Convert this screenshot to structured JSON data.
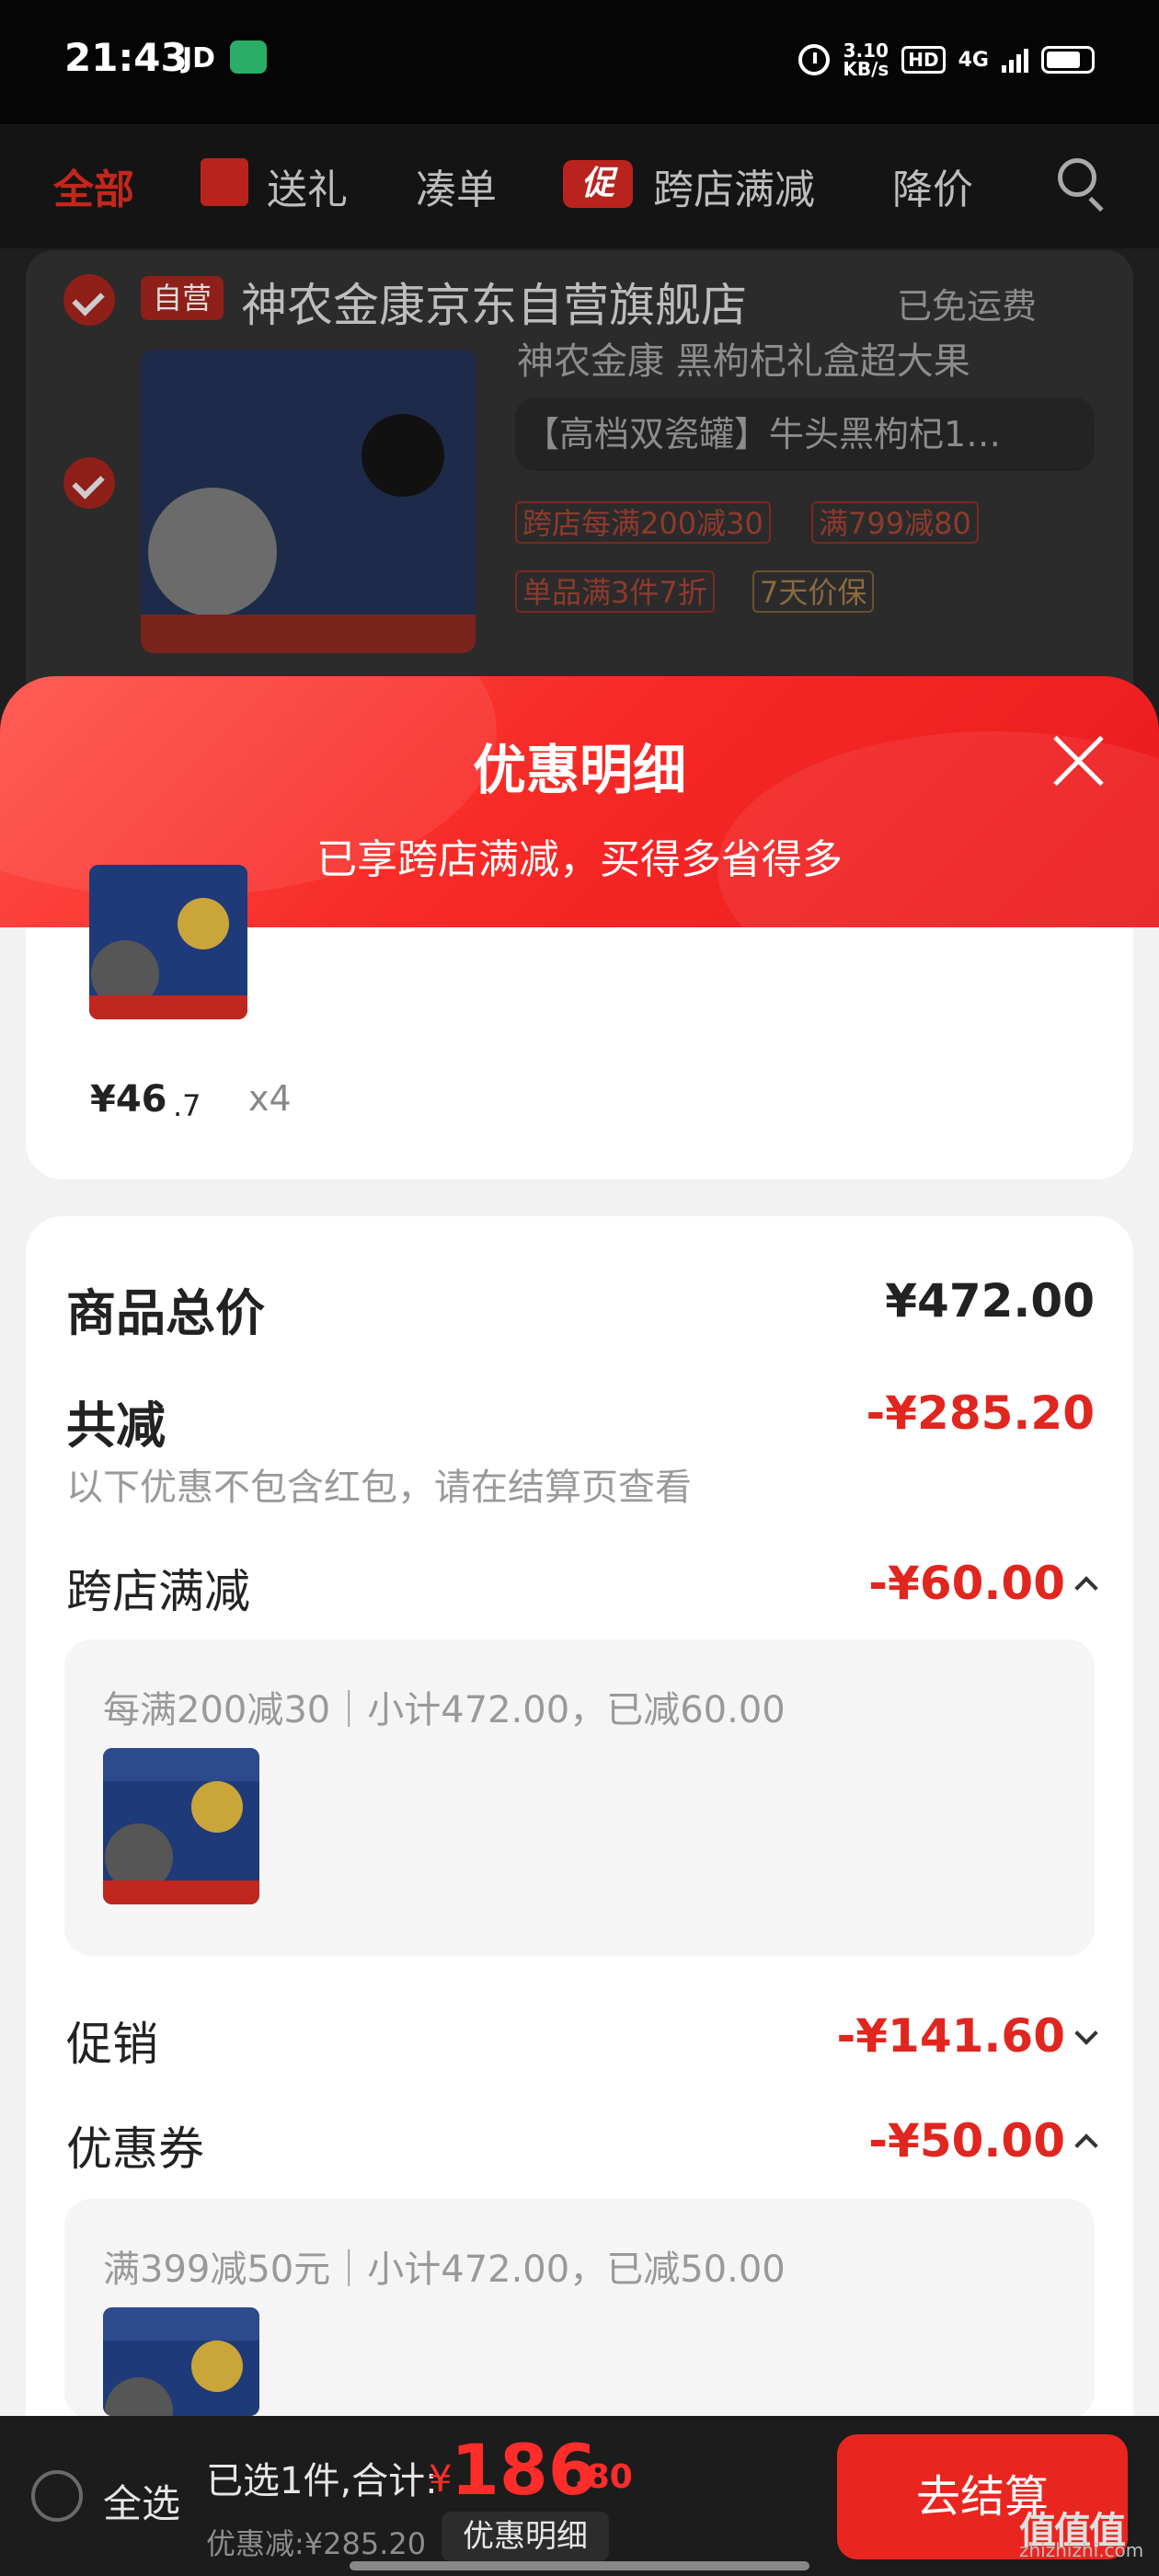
{
  "status_bar": {
    "time": "21:43",
    "app_tag": "JD",
    "speed": "3.10",
    "speed_unit": "KB/s",
    "hd": "HD",
    "network": "4G"
  },
  "tabs": [
    {
      "label": "全部",
      "active": true
    },
    {
      "label": "送礼",
      "icon": "gift-icon"
    },
    {
      "label": "凑单"
    },
    {
      "label": "跨店满减",
      "badge": "促"
    },
    {
      "label": "降价"
    }
  ],
  "shop": {
    "badge": "自营",
    "name": "神农金康京东自营旗舰店",
    "shipping": "已免运费",
    "product": {
      "title_partial": "神农金康 黑枸杞礼盒超大果",
      "spec": "【高档双瓷罐】牛头黑枸杞1…",
      "tags": [
        "跨店每满200减30",
        "满799减80",
        "单品满3件7折",
        "7天价保"
      ]
    }
  },
  "sheet": {
    "title": "优惠明细",
    "subtitle": "已享跨店满减，买得多省得多",
    "item": {
      "price_int": "¥46",
      "price_dec": ".7",
      "qty": "x4"
    },
    "total_label": "商品总价",
    "total_value": "¥472.00",
    "reduce_label": "共减",
    "reduce_value": "-¥285.20",
    "reduce_note": "以下优惠不包含红包，请在结算页查看",
    "cross_label": "跨店满减",
    "cross_value": "-¥60.00",
    "cross_detail": "每满200减30｜小计472.00，已减60.00",
    "promo_label": "促销",
    "promo_value": "-¥141.60",
    "coupon_label": "优惠券",
    "coupon_value": "-¥50.00",
    "coupon_detail": "满399减50元｜小计472.00，已减50.00"
  },
  "bottom_bar": {
    "select_all": "全选",
    "selected": "已选1件,合计:",
    "currency": "¥",
    "total_int": "186",
    "total_dec": ".80",
    "discount": "优惠减:¥285.20",
    "detail_button": "优惠明细",
    "checkout": "去结算"
  },
  "watermark": {
    "main": "值值值",
    "sub": "zhizhizhi.com"
  },
  "colors": {
    "accent_red": "#e0261f",
    "header_red": "#f72a27",
    "dark_bg": "#1e1e1e"
  }
}
